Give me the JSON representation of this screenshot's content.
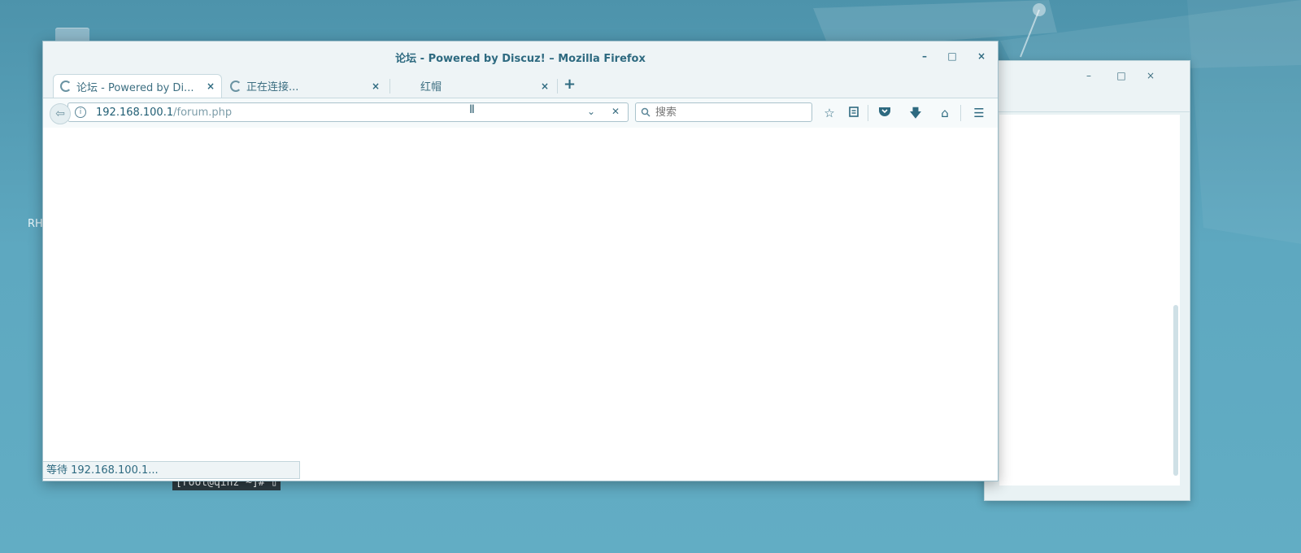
{
  "desktop": {
    "icon_label": "RH"
  },
  "background_window": {
    "minimize": "–",
    "maximize": "□",
    "close": "×"
  },
  "terminal_peek": {
    "text": "[root@qinz ~]# ▯"
  },
  "firefox": {
    "window_title": "论坛 - Powered by Discuz! – Mozilla Firefox",
    "controls": {
      "minimize": "–",
      "maximize": "□",
      "close": "×"
    },
    "tabs": [
      {
        "label": "论坛 - Powered by Di...",
        "state": "loading",
        "active": true
      },
      {
        "label": "正在连接...",
        "state": "loading",
        "active": false
      },
      {
        "label": "红帽",
        "state": "idle",
        "active": false
      }
    ],
    "tab_close_glyph": "×",
    "new_tab_glyph": "+",
    "url": {
      "host": "192.168.100.1",
      "path": "/forum.php"
    },
    "search_placeholder": "搜索",
    "toolbar_icons": [
      "bookmark-star-icon",
      "reading-list-icon",
      "pocket-icon",
      "download-icon",
      "home-icon",
      "menu-icon"
    ],
    "status_text": "等待 192.168.100.1..."
  },
  "colors": {
    "accent": "#2e6a80",
    "desktop": "#5ea8c0"
  }
}
